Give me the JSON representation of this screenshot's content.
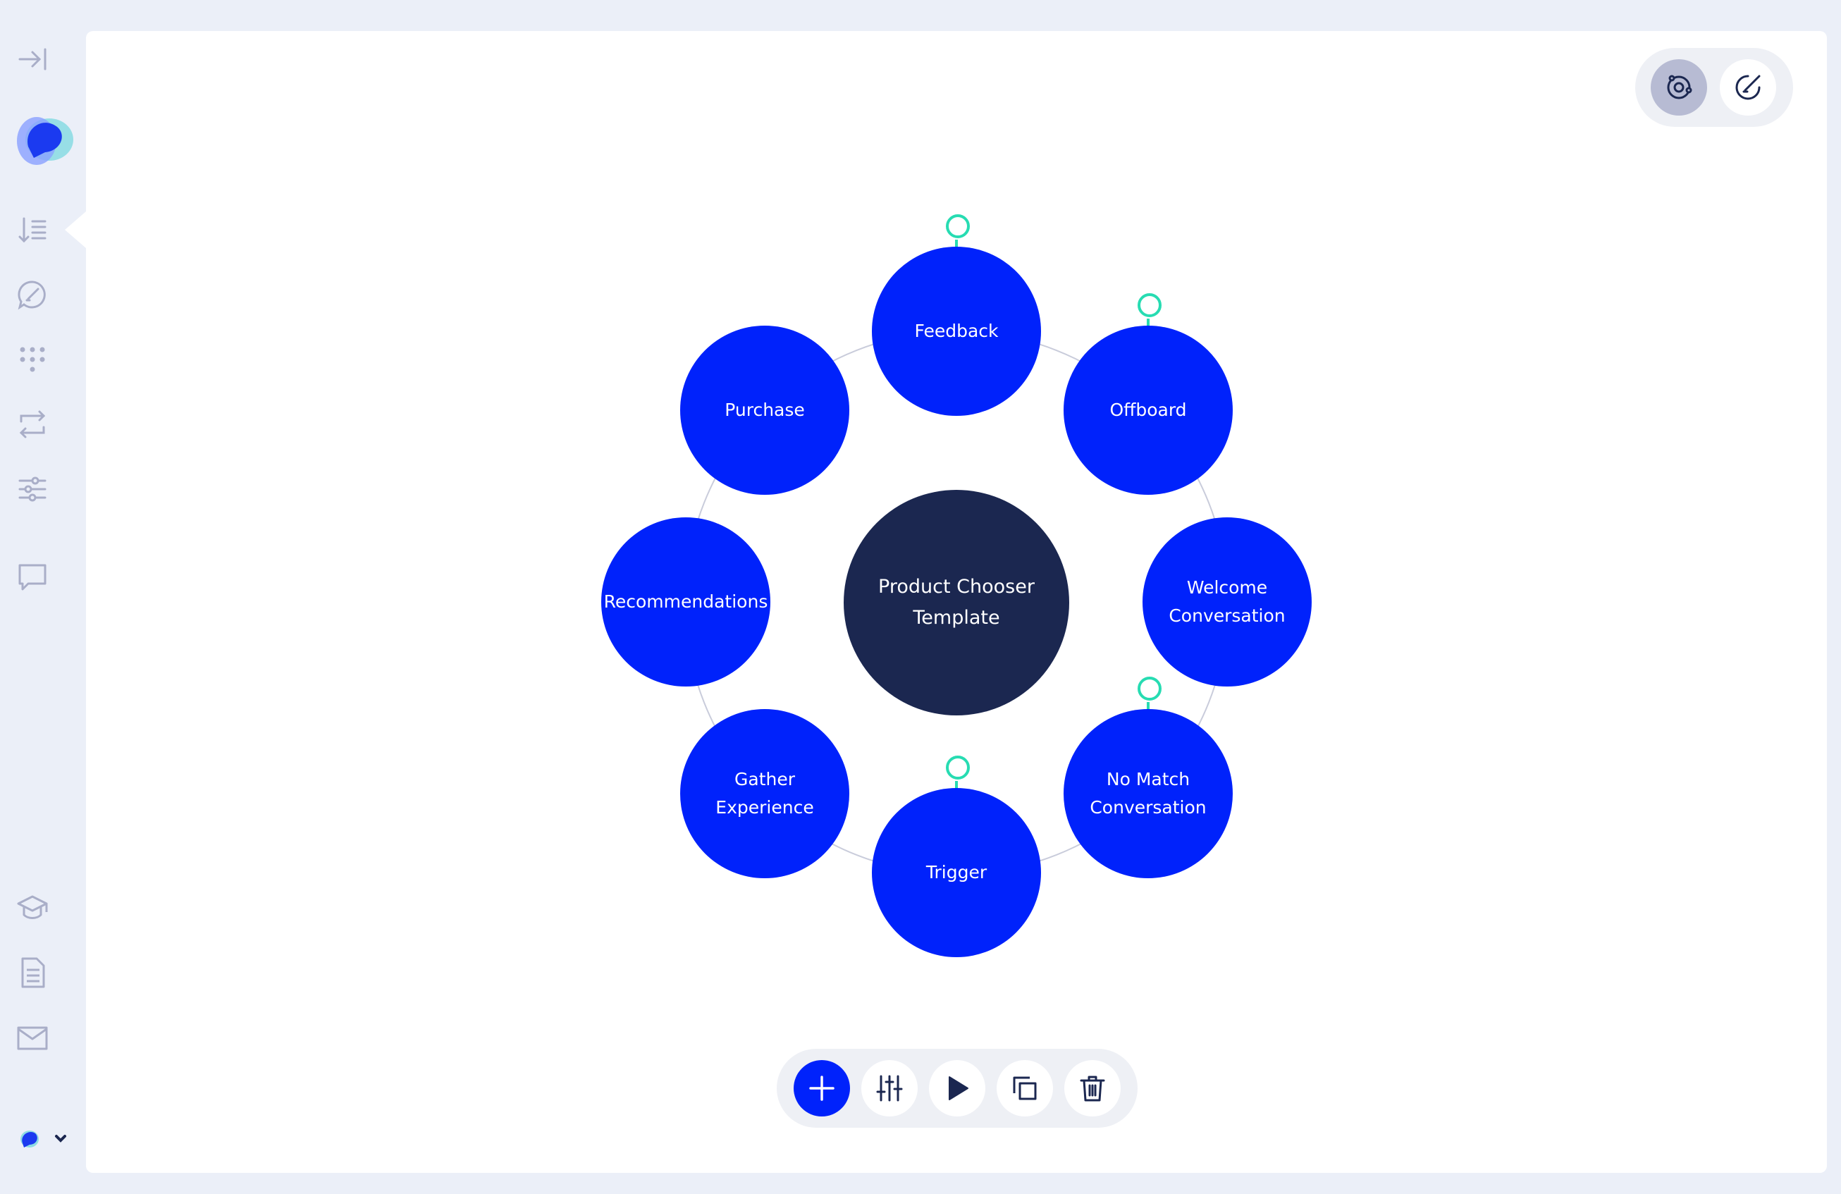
{
  "sidebar": {
    "items": [
      {
        "icon": "collapse-sidebar-icon"
      },
      {
        "icon": "app-logo"
      },
      {
        "icon": "flows-list-icon"
      },
      {
        "icon": "conversation-edit-icon"
      },
      {
        "icon": "grid-dots-icon"
      },
      {
        "icon": "swap-arrows-icon"
      },
      {
        "icon": "settings-sliders-icon"
      },
      {
        "icon": "chat-bubble-icon"
      },
      {
        "icon": "academy-hat-icon"
      },
      {
        "icon": "document-icon"
      },
      {
        "icon": "mail-icon"
      },
      {
        "icon": "workspace-switcher-icon"
      }
    ]
  },
  "view_toggle": {
    "options": [
      {
        "icon": "graph-view-icon",
        "active": true
      },
      {
        "icon": "edit-view-icon",
        "active": false
      }
    ]
  },
  "diagram": {
    "center": {
      "label": "Product Chooser\nTemplate"
    },
    "nodes": [
      {
        "id": "feedback",
        "label": "Feedback",
        "has_pin": true
      },
      {
        "id": "offboard",
        "label": "Offboard",
        "has_pin": true
      },
      {
        "id": "welcome",
        "label": "Welcome\nConversation",
        "has_pin": false
      },
      {
        "id": "no-match",
        "label": "No Match\nConversation",
        "has_pin": true
      },
      {
        "id": "trigger",
        "label": "Trigger",
        "has_pin": true
      },
      {
        "id": "gather",
        "label": "Gather\nExperience",
        "has_pin": false
      },
      {
        "id": "recommendations",
        "label": "Recommendations",
        "has_pin": false
      },
      {
        "id": "purchase",
        "label": "Purchase",
        "has_pin": false
      }
    ]
  },
  "toolbar": {
    "buttons": [
      {
        "icon": "add-icon"
      },
      {
        "icon": "settings-sliders-icon"
      },
      {
        "icon": "play-icon"
      },
      {
        "icon": "duplicate-icon"
      },
      {
        "icon": "delete-icon"
      }
    ]
  },
  "colors": {
    "node_blue": "#0022fb",
    "center_navy": "#1b2750",
    "pin_teal": "#27dcb2",
    "background": "#ebeff8"
  }
}
